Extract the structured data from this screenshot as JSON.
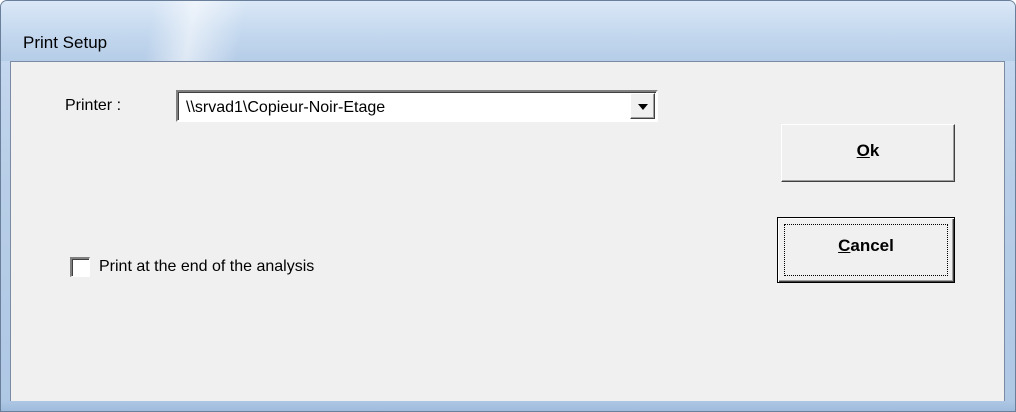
{
  "window": {
    "title": "Print Setup"
  },
  "printer": {
    "label": "Printer :",
    "selected_value": "\\\\srvad1\\Copieur-Noir-Etage"
  },
  "options": {
    "print_at_end_label": "Print at the end of the analysis",
    "print_at_end_checked": false
  },
  "buttons": {
    "ok_mnemonic": "O",
    "ok_rest": "k",
    "cancel_mnemonic": "C",
    "cancel_rest": "ancel"
  },
  "icons": {
    "dropdown": "chevron-down-icon"
  }
}
